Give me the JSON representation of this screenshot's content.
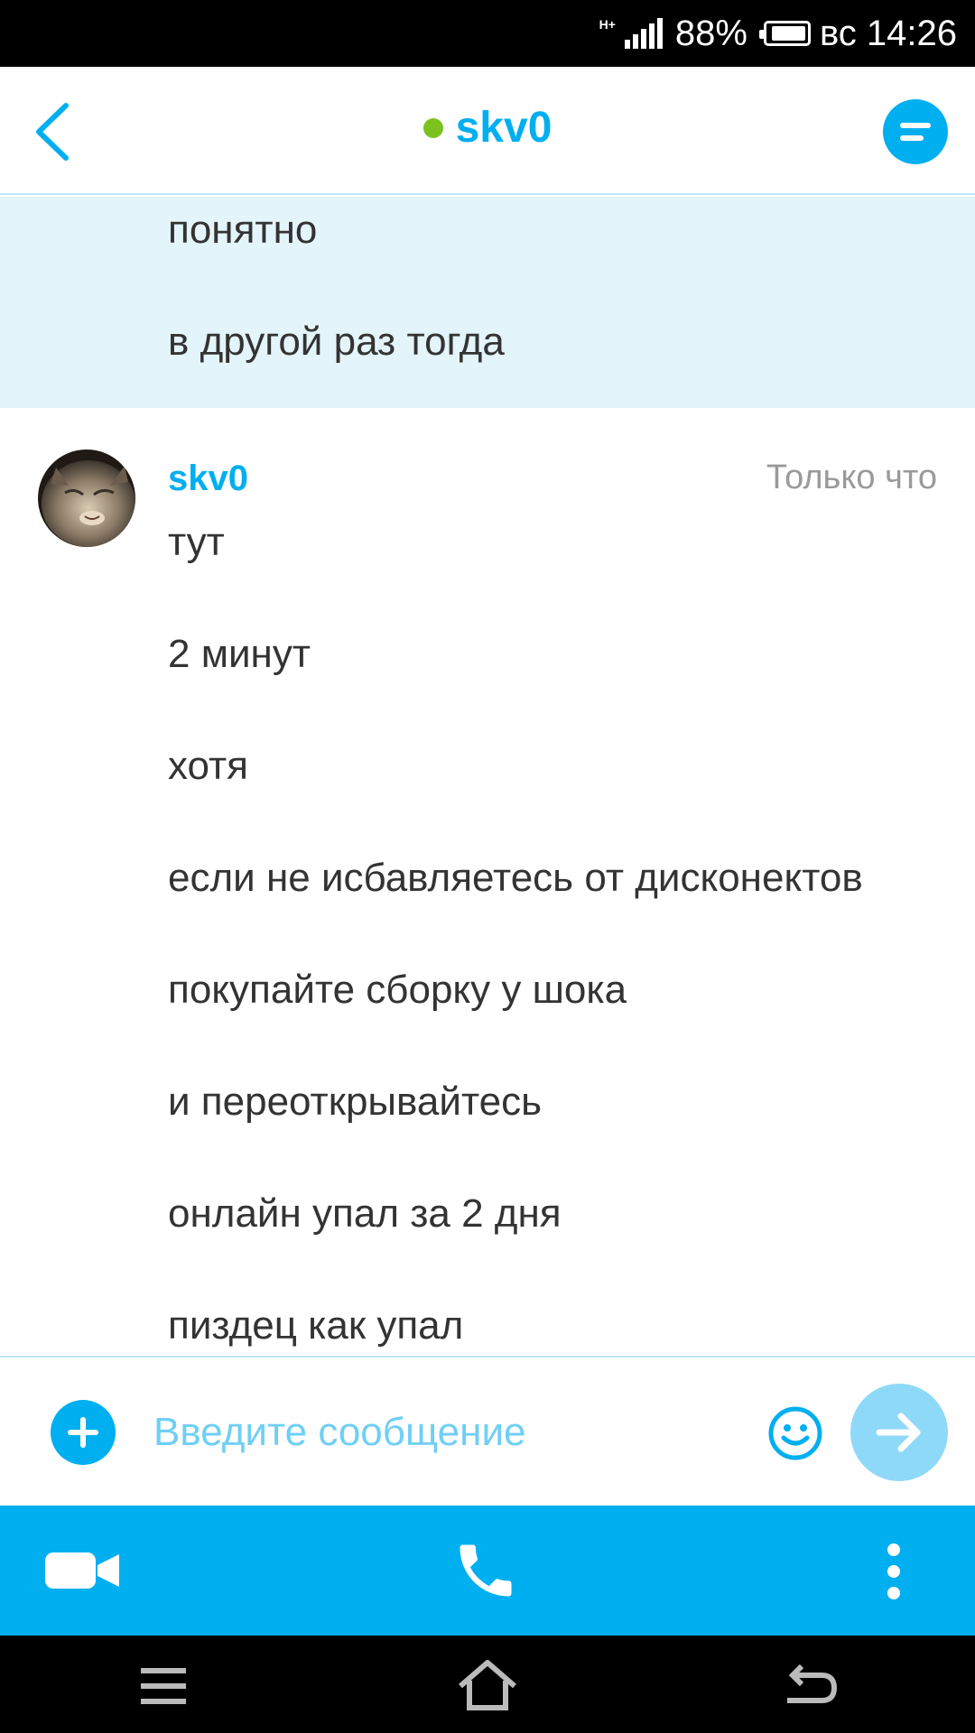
{
  "status_bar": {
    "network": "H+",
    "battery_percent": "88%",
    "battery_level": 0.88,
    "time": "вс 14:26"
  },
  "header": {
    "title": "skv0",
    "online": true,
    "online_color": "#7cc21e",
    "accent_color": "#00aff0",
    "back_icon": "chevron-left-icon",
    "profile_icon": "chat-info-icon"
  },
  "chat": {
    "previous_messages": [
      "понятно",
      "в другой раз тогда"
    ],
    "sender": {
      "name": "skv0",
      "timestamp": "Только что",
      "messages": [
        "тут",
        "2 минут",
        "хотя",
        "если не исбавляетесь от дисконектов",
        "покупайте сборку у шока",
        "и переоткрывайтесь",
        "онлайн упал за 2 дня",
        "пиздец как упал"
      ]
    }
  },
  "composer": {
    "placeholder": "Введите сообщение",
    "value": "",
    "add_icon": "plus-icon",
    "emoji_icon": "smiley-icon",
    "send_icon": "arrow-right-icon"
  },
  "call_bar": {
    "video_icon": "video-camera-icon",
    "call_icon": "phone-icon",
    "more_icon": "more-vertical-icon"
  },
  "nav_bar": {
    "menu_icon": "menu-icon",
    "home_icon": "home-icon",
    "back_icon": "back-arrow-icon"
  }
}
